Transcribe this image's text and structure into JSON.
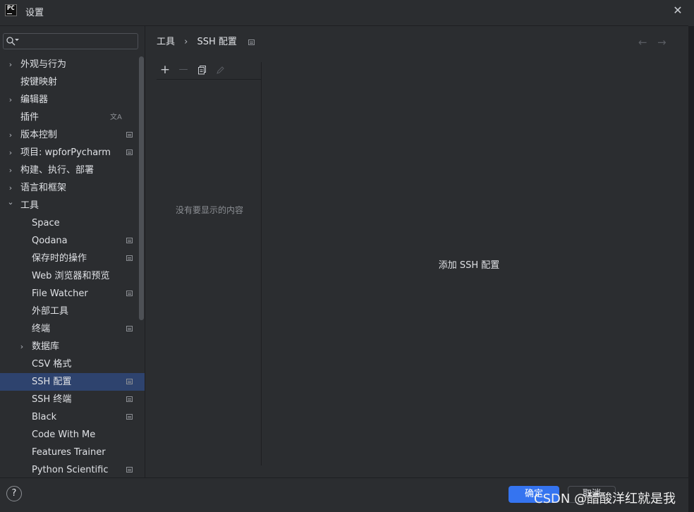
{
  "window": {
    "app_icon": "PC",
    "title": "设置",
    "close_icon": "close-icon"
  },
  "sidebar": {
    "search": {
      "value": "",
      "placeholder": ""
    },
    "items": [
      {
        "label": "外观与行为",
        "indent": 0,
        "chevron": "right",
        "icon": ""
      },
      {
        "label": "按键映射",
        "indent": 0,
        "chevron": "",
        "icon": ""
      },
      {
        "label": "编辑器",
        "indent": 0,
        "chevron": "right",
        "icon": ""
      },
      {
        "label": "插件",
        "indent": 0,
        "chevron": "",
        "icon": "translate-icon"
      },
      {
        "label": "版本控制",
        "indent": 0,
        "chevron": "right",
        "icon": "project-icon"
      },
      {
        "label": "项目: wpforPycharm",
        "indent": 0,
        "chevron": "right",
        "icon": "project-icon"
      },
      {
        "label": "构建、执行、部署",
        "indent": 0,
        "chevron": "right",
        "icon": ""
      },
      {
        "label": "语言和框架",
        "indent": 0,
        "chevron": "right",
        "icon": ""
      },
      {
        "label": "工具",
        "indent": 0,
        "chevron": "down",
        "icon": ""
      },
      {
        "label": "Space",
        "indent": 1,
        "chevron": "",
        "icon": ""
      },
      {
        "label": "Qodana",
        "indent": 1,
        "chevron": "",
        "icon": "project-icon"
      },
      {
        "label": "保存时的操作",
        "indent": 1,
        "chevron": "",
        "icon": "project-icon"
      },
      {
        "label": "Web 浏览器和预览",
        "indent": 1,
        "chevron": "",
        "icon": ""
      },
      {
        "label": "File Watcher",
        "indent": 1,
        "chevron": "",
        "icon": "project-icon"
      },
      {
        "label": "外部工具",
        "indent": 1,
        "chevron": "",
        "icon": ""
      },
      {
        "label": "终端",
        "indent": 1,
        "chevron": "",
        "icon": "project-icon"
      },
      {
        "label": "数据库",
        "indent": 1,
        "chevron": "right",
        "icon": ""
      },
      {
        "label": "CSV 格式",
        "indent": 1,
        "chevron": "",
        "icon": ""
      },
      {
        "label": "SSH 配置",
        "indent": 1,
        "chevron": "",
        "icon": "project-icon",
        "selected": true
      },
      {
        "label": "SSH 终端",
        "indent": 1,
        "chevron": "",
        "icon": "project-icon"
      },
      {
        "label": "Black",
        "indent": 1,
        "chevron": "",
        "icon": "project-icon"
      },
      {
        "label": "Code With Me",
        "indent": 1,
        "chevron": "",
        "icon": ""
      },
      {
        "label": "Features Trainer",
        "indent": 1,
        "chevron": "",
        "icon": ""
      },
      {
        "label": "Python Scientific",
        "indent": 1,
        "chevron": "",
        "icon": "project-icon"
      }
    ]
  },
  "breadcrumb": {
    "parent": "工具",
    "current": "SSH 配置"
  },
  "toolbar": {
    "add": "+",
    "remove": "—",
    "copy_icon": "copy-icon",
    "edit_icon": "edit-icon"
  },
  "list": {
    "empty_text": "没有要显示的内容"
  },
  "detail": {
    "add_config_text": "添加 SSH 配置"
  },
  "footer": {
    "help": "?",
    "ok": "确定",
    "cancel": "取消"
  },
  "watermark": "CSDN @醋酸洋红就是我",
  "colors": {
    "background": "#2b2d30",
    "selection": "#2e436e",
    "accent": "#3574f0"
  }
}
